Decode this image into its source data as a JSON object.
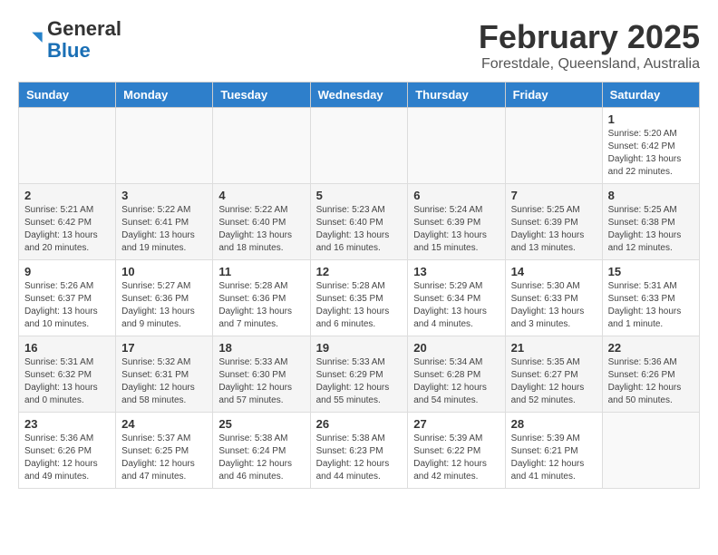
{
  "header": {
    "logo_general": "General",
    "logo_blue": "Blue",
    "title": "February 2025",
    "subtitle": "Forestdale, Queensland, Australia"
  },
  "calendar": {
    "days_of_week": [
      "Sunday",
      "Monday",
      "Tuesday",
      "Wednesday",
      "Thursday",
      "Friday",
      "Saturday"
    ],
    "weeks": [
      [
        {
          "day": "",
          "info": ""
        },
        {
          "day": "",
          "info": ""
        },
        {
          "day": "",
          "info": ""
        },
        {
          "day": "",
          "info": ""
        },
        {
          "day": "",
          "info": ""
        },
        {
          "day": "",
          "info": ""
        },
        {
          "day": "1",
          "info": "Sunrise: 5:20 AM\nSunset: 6:42 PM\nDaylight: 13 hours\nand 22 minutes."
        }
      ],
      [
        {
          "day": "2",
          "info": "Sunrise: 5:21 AM\nSunset: 6:42 PM\nDaylight: 13 hours\nand 20 minutes."
        },
        {
          "day": "3",
          "info": "Sunrise: 5:22 AM\nSunset: 6:41 PM\nDaylight: 13 hours\nand 19 minutes."
        },
        {
          "day": "4",
          "info": "Sunrise: 5:22 AM\nSunset: 6:40 PM\nDaylight: 13 hours\nand 18 minutes."
        },
        {
          "day": "5",
          "info": "Sunrise: 5:23 AM\nSunset: 6:40 PM\nDaylight: 13 hours\nand 16 minutes."
        },
        {
          "day": "6",
          "info": "Sunrise: 5:24 AM\nSunset: 6:39 PM\nDaylight: 13 hours\nand 15 minutes."
        },
        {
          "day": "7",
          "info": "Sunrise: 5:25 AM\nSunset: 6:39 PM\nDaylight: 13 hours\nand 13 minutes."
        },
        {
          "day": "8",
          "info": "Sunrise: 5:25 AM\nSunset: 6:38 PM\nDaylight: 13 hours\nand 12 minutes."
        }
      ],
      [
        {
          "day": "9",
          "info": "Sunrise: 5:26 AM\nSunset: 6:37 PM\nDaylight: 13 hours\nand 10 minutes."
        },
        {
          "day": "10",
          "info": "Sunrise: 5:27 AM\nSunset: 6:36 PM\nDaylight: 13 hours\nand 9 minutes."
        },
        {
          "day": "11",
          "info": "Sunrise: 5:28 AM\nSunset: 6:36 PM\nDaylight: 13 hours\nand 7 minutes."
        },
        {
          "day": "12",
          "info": "Sunrise: 5:28 AM\nSunset: 6:35 PM\nDaylight: 13 hours\nand 6 minutes."
        },
        {
          "day": "13",
          "info": "Sunrise: 5:29 AM\nSunset: 6:34 PM\nDaylight: 13 hours\nand 4 minutes."
        },
        {
          "day": "14",
          "info": "Sunrise: 5:30 AM\nSunset: 6:33 PM\nDaylight: 13 hours\nand 3 minutes."
        },
        {
          "day": "15",
          "info": "Sunrise: 5:31 AM\nSunset: 6:33 PM\nDaylight: 13 hours\nand 1 minute."
        }
      ],
      [
        {
          "day": "16",
          "info": "Sunrise: 5:31 AM\nSunset: 6:32 PM\nDaylight: 13 hours\nand 0 minutes."
        },
        {
          "day": "17",
          "info": "Sunrise: 5:32 AM\nSunset: 6:31 PM\nDaylight: 12 hours\nand 58 minutes."
        },
        {
          "day": "18",
          "info": "Sunrise: 5:33 AM\nSunset: 6:30 PM\nDaylight: 12 hours\nand 57 minutes."
        },
        {
          "day": "19",
          "info": "Sunrise: 5:33 AM\nSunset: 6:29 PM\nDaylight: 12 hours\nand 55 minutes."
        },
        {
          "day": "20",
          "info": "Sunrise: 5:34 AM\nSunset: 6:28 PM\nDaylight: 12 hours\nand 54 minutes."
        },
        {
          "day": "21",
          "info": "Sunrise: 5:35 AM\nSunset: 6:27 PM\nDaylight: 12 hours\nand 52 minutes."
        },
        {
          "day": "22",
          "info": "Sunrise: 5:36 AM\nSunset: 6:26 PM\nDaylight: 12 hours\nand 50 minutes."
        }
      ],
      [
        {
          "day": "23",
          "info": "Sunrise: 5:36 AM\nSunset: 6:26 PM\nDaylight: 12 hours\nand 49 minutes."
        },
        {
          "day": "24",
          "info": "Sunrise: 5:37 AM\nSunset: 6:25 PM\nDaylight: 12 hours\nand 47 minutes."
        },
        {
          "day": "25",
          "info": "Sunrise: 5:38 AM\nSunset: 6:24 PM\nDaylight: 12 hours\nand 46 minutes."
        },
        {
          "day": "26",
          "info": "Sunrise: 5:38 AM\nSunset: 6:23 PM\nDaylight: 12 hours\nand 44 minutes."
        },
        {
          "day": "27",
          "info": "Sunrise: 5:39 AM\nSunset: 6:22 PM\nDaylight: 12 hours\nand 42 minutes."
        },
        {
          "day": "28",
          "info": "Sunrise: 5:39 AM\nSunset: 6:21 PM\nDaylight: 12 hours\nand 41 minutes."
        },
        {
          "day": "",
          "info": ""
        }
      ]
    ]
  }
}
